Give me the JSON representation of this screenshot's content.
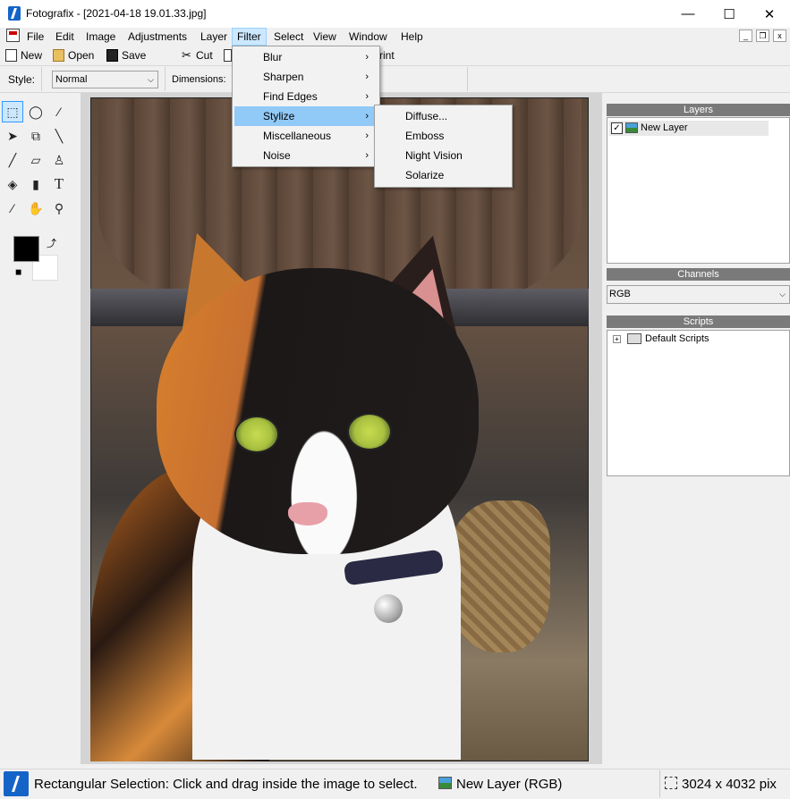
{
  "window": {
    "title": "Fotografix - [2021-04-18 19.01.33.jpg]",
    "min": "—",
    "max": "☐",
    "close": "✕"
  },
  "menu": {
    "items": [
      "File",
      "Edit",
      "Image",
      "Adjustments",
      "Layer",
      "Filter",
      "Select",
      "View",
      "Window",
      "Help"
    ],
    "active": "Filter"
  },
  "mdi": {
    "min": "_",
    "restore": "❐",
    "close": "x"
  },
  "toolbar": {
    "new": "New",
    "open": "Open",
    "save": "Save",
    "cut": "Cut",
    "print_partial": "rint"
  },
  "options": {
    "style_label": "Style:",
    "style_value": "Normal",
    "dimensions_label": "Dimensions:"
  },
  "filter_menu": {
    "items": [
      {
        "label": "Blur",
        "submenu": true
      },
      {
        "label": "Sharpen",
        "submenu": true
      },
      {
        "label": "Find Edges",
        "submenu": true
      },
      {
        "label": "Stylize",
        "submenu": true,
        "highlighted": true
      },
      {
        "label": "Miscellaneous",
        "submenu": true
      },
      {
        "label": "Noise",
        "submenu": true
      }
    ]
  },
  "stylize_menu": {
    "items": [
      "Diffuse...",
      "Emboss",
      "Night Vision",
      "Solarize"
    ]
  },
  "panels": {
    "layers": {
      "title": "Layers",
      "items": [
        {
          "name": "New Layer",
          "visible": true
        }
      ]
    },
    "channels": {
      "title": "Channels",
      "selected": "RGB"
    },
    "scripts": {
      "title": "Scripts",
      "items": [
        "Default Scripts"
      ]
    }
  },
  "status": {
    "message": "Rectangular Selection: Click and drag inside the image to select.",
    "layer": "New Layer (RGB)",
    "dimensions": "3024 x 4032 pix"
  },
  "tools": [
    "rect-select",
    "ellipse-select",
    "magic-wand",
    "move",
    "crop",
    "measure",
    "brush",
    "eraser",
    "clone-stamp",
    "paint-bucket",
    "gradient",
    "text",
    "eyedropper",
    "hand",
    "zoom"
  ]
}
